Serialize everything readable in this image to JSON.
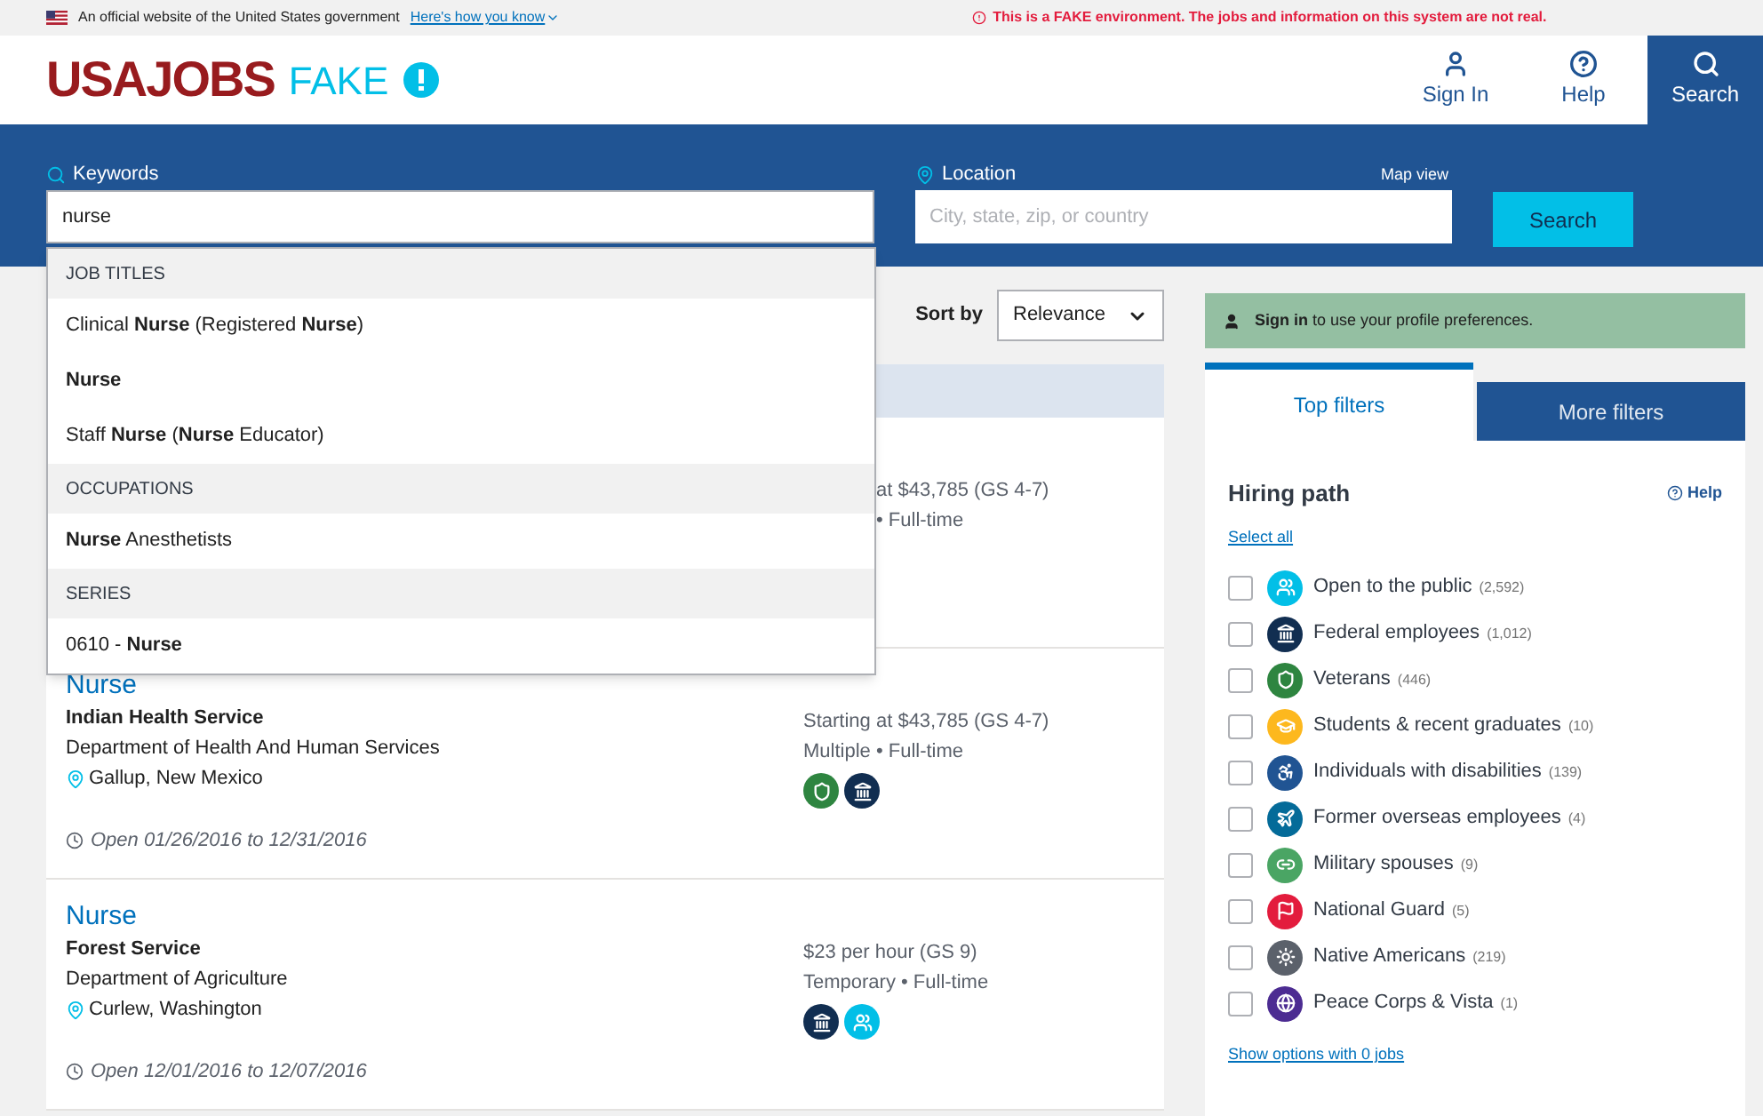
{
  "gov_banner": {
    "text": "An official website of the United States government",
    "link": "Here's how you know",
    "warning": "This is a FAKE environment. The jobs and information on this system are not real."
  },
  "header": {
    "logo": "USAJOBS",
    "logo_tag": "FAKE",
    "nav": [
      {
        "kind": "user",
        "label": "Sign In",
        "selected": false
      },
      {
        "kind": "help",
        "label": "Help",
        "selected": false
      },
      {
        "kind": "search",
        "label": "Search",
        "selected": true
      }
    ]
  },
  "search": {
    "keywords_label": "Keywords",
    "keywords_value": "nurse",
    "location_label": "Location",
    "location_placeholder": "City, state, zip, or country",
    "map_view": "Map view",
    "button": "Search"
  },
  "suggestions": [
    {
      "heading": "JOB TITLES",
      "items": [
        "Clinical **Nurse** (Registered **Nurse**)",
        "**Nurse**",
        "Staff **Nurse** (**Nurse** Educator)"
      ]
    },
    {
      "heading": "OCCUPATIONS",
      "items": [
        "**Nurse** Anesthetists"
      ]
    },
    {
      "heading": "SERIES",
      "items": [
        "0610 - **Nurse**"
      ]
    }
  ],
  "sort": {
    "label": "Sort by",
    "value": "Relevance"
  },
  "jobs": [
    {
      "kind": "partial",
      "salary": "at $43,785 (GS 4-7)",
      "schedule": "• Full-time"
    },
    {
      "kind": "full",
      "title": "Nurse",
      "agency": "Indian Health Service",
      "department": "Department of Health And Human Services",
      "location": "Gallup, New Mexico",
      "salary": "Starting at $43,785 (GS 4-7)",
      "schedule": "Multiple • Full-time",
      "paths": [
        {
          "kind": "veterans"
        },
        {
          "kind": "federal"
        }
      ],
      "dates": "Open 01/26/2016 to 12/31/2016"
    },
    {
      "kind": "full",
      "title": "Nurse",
      "agency": "Forest Service",
      "department": "Department of Agriculture",
      "location": "Curlew, Washington",
      "salary": "$23 per hour (GS 9)",
      "schedule": "Temporary • Full-time",
      "paths": [
        {
          "kind": "federal"
        },
        {
          "kind": "public"
        }
      ],
      "dates": "Open 12/01/2016 to 12/07/2016"
    }
  ],
  "signin_notice": {
    "link": "Sign in",
    "text": "to use your profile preferences."
  },
  "filter_tabs": [
    {
      "label": "Top filters",
      "selected": true
    },
    {
      "label": "More filters",
      "selected": false
    }
  ],
  "hiring_path": {
    "title": "Hiring path",
    "help": "Help",
    "select_all": "Select all",
    "show_more": "Show options with 0 jobs",
    "options": [
      {
        "kind": "public",
        "label": "Open to the public",
        "count": "(2,592)",
        "checked": false
      },
      {
        "kind": "federal",
        "label": "Federal employees",
        "count": "(1,012)",
        "checked": false
      },
      {
        "kind": "veterans",
        "label": "Veterans",
        "count": "(446)",
        "checked": false
      },
      {
        "kind": "students",
        "label": "Students & recent graduates",
        "count": "(10)",
        "checked": false
      },
      {
        "kind": "disabilities",
        "label": "Individuals with disabilities",
        "count": "(139)",
        "checked": false
      },
      {
        "kind": "overseas",
        "label": "Former overseas employees",
        "count": "(4)",
        "checked": false
      },
      {
        "kind": "spouses",
        "label": "Military spouses",
        "count": "(9)",
        "checked": false
      },
      {
        "kind": "guard",
        "label": "National Guard",
        "count": "(5)",
        "checked": false
      },
      {
        "kind": "native",
        "label": "Native Americans",
        "count": "(219)",
        "checked": false
      },
      {
        "kind": "peace",
        "label": "Peace Corps & Vista",
        "count": "(1)",
        "checked": false
      }
    ]
  }
}
